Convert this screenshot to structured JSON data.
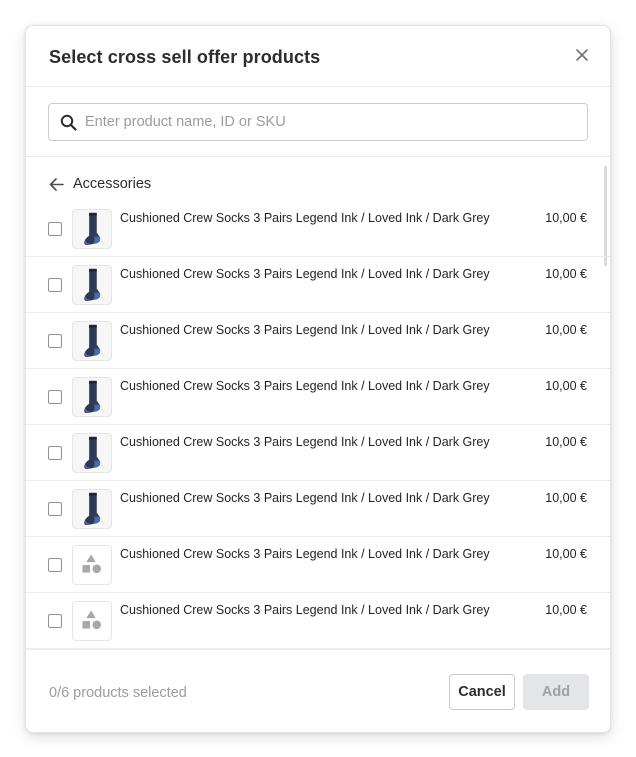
{
  "modal": {
    "title": "Select cross sell offer products",
    "close_icon": "close-icon"
  },
  "search": {
    "placeholder": "Enter product name, ID or SKU",
    "value": "",
    "icon": "search-icon"
  },
  "breadcrumb": {
    "back_icon": "arrow-left-icon",
    "label": "Accessories"
  },
  "products": [
    {
      "name": "Cushioned Crew Socks 3 Pairs Legend Ink / Loved Ink / Dark Grey",
      "price": "10,00 €",
      "image": "sock-image",
      "checked": false
    },
    {
      "name": "Cushioned Crew Socks 3 Pairs Legend Ink / Loved Ink / Dark Grey",
      "price": "10,00 €",
      "image": "sock-image",
      "checked": false
    },
    {
      "name": "Cushioned Crew Socks 3 Pairs Legend Ink / Loved Ink / Dark Grey",
      "price": "10,00 €",
      "image": "sock-image",
      "checked": false
    },
    {
      "name": "Cushioned Crew Socks 3 Pairs Legend Ink / Loved Ink / Dark Grey",
      "price": "10,00 €",
      "image": "sock-image",
      "checked": false
    },
    {
      "name": "Cushioned Crew Socks 3 Pairs Legend Ink / Loved Ink / Dark Grey",
      "price": "10,00 €",
      "image": "sock-image",
      "checked": false
    },
    {
      "name": "Cushioned Crew Socks 3 Pairs Legend Ink / Loved Ink / Dark Grey",
      "price": "10,00 €",
      "image": "sock-image",
      "checked": false
    },
    {
      "name": "Cushioned Crew Socks 3 Pairs Legend Ink / Loved Ink / Dark Grey",
      "price": "10,00 €",
      "image": "shapes-placeholder-icon",
      "checked": false
    },
    {
      "name": "Cushioned Crew Socks 3 Pairs Legend Ink / Loved Ink / Dark Grey",
      "price": "10,00 €",
      "image": "shapes-placeholder-icon",
      "checked": false
    }
  ],
  "footer": {
    "selected_text": "0/6 products selected",
    "cancel_label": "Cancel",
    "add_label": "Add"
  },
  "colors": {
    "sock": "#2e3a55",
    "sock_heel": "#4a6aa8",
    "placeholder_icon": "#a6a8ae",
    "border": "#ececef",
    "add_disabled_bg": "#e4e5e8"
  }
}
